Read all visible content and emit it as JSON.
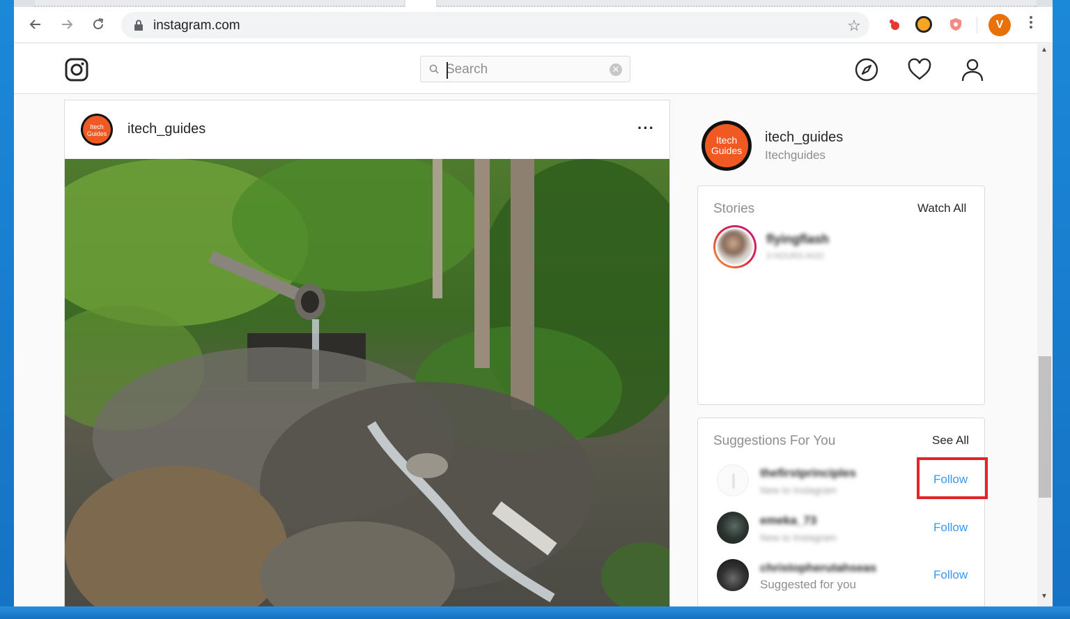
{
  "browser": {
    "url": "instagram.com",
    "profile_initial": "V"
  },
  "ig": {
    "search": {
      "placeholder": "Search"
    },
    "post": {
      "username": "itech_guides",
      "avatar_text": "Itech Guides",
      "more_label": "···"
    },
    "me": {
      "username": "itech_guides",
      "fullname": "Itechguides",
      "avatar_text": "Itech Guides"
    },
    "stories": {
      "title": "Stories",
      "watch_all": "Watch All",
      "items": [
        {
          "name": "flyingflash",
          "time": "3 HOURS AGO"
        }
      ]
    },
    "suggestions": {
      "title": "Suggestions For You",
      "see_all": "See All",
      "items": [
        {
          "name": "thefirstprinciples",
          "sub": "New to Instagram",
          "action": "Follow"
        },
        {
          "name": "emeka_73",
          "sub": "New to Instagram",
          "action": "Follow"
        },
        {
          "name": "christopherutahseas",
          "sub": "Suggested for you",
          "action": "Follow"
        }
      ]
    }
  },
  "colors": {
    "accent": "#3897f0",
    "highlight": "#e3242b",
    "brand_orange": "#f05a22"
  }
}
